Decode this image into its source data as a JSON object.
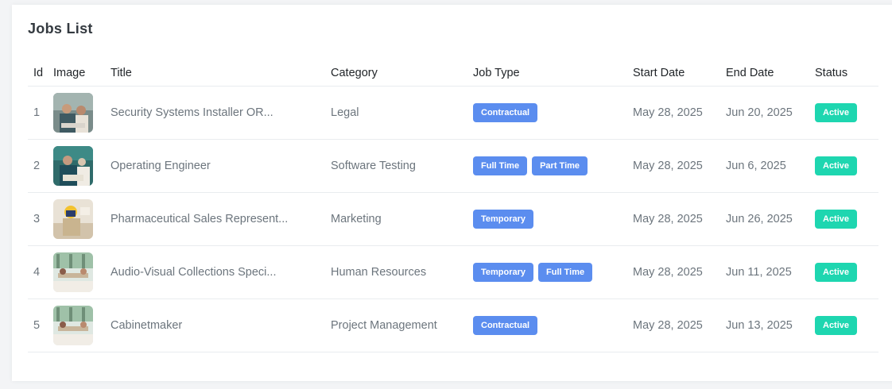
{
  "card": {
    "title": "Jobs List"
  },
  "table": {
    "headers": {
      "id": "Id",
      "image": "Image",
      "title": "Title",
      "category": "Category",
      "job_type": "Job Type",
      "start_date": "Start Date",
      "end_date": "End Date",
      "status": "Status"
    },
    "rows": [
      {
        "id": "1",
        "title": "Security Systems Installer OR...",
        "category": "Legal",
        "types": [
          "Contractual"
        ],
        "start": "May 28, 2025",
        "end": "Jun 20, 2025",
        "status": "Active"
      },
      {
        "id": "2",
        "title": "Operating Engineer",
        "category": "Software Testing",
        "types": [
          "Full Time",
          "Part Time"
        ],
        "start": "May 28, 2025",
        "end": "Jun 6, 2025",
        "status": "Active"
      },
      {
        "id": "3",
        "title": "Pharmaceutical Sales Represent...",
        "category": "Marketing",
        "types": [
          "Temporary"
        ],
        "start": "May 28, 2025",
        "end": "Jun 26, 2025",
        "status": "Active"
      },
      {
        "id": "4",
        "title": "Audio-Visual Collections Speci...",
        "category": "Human Resources",
        "types": [
          "Temporary",
          "Full Time"
        ],
        "start": "May 28, 2025",
        "end": "Jun 11, 2025",
        "status": "Active"
      },
      {
        "id": "5",
        "title": "Cabinetmaker",
        "category": "Project Management",
        "types": [
          "Contractual"
        ],
        "start": "May 28, 2025",
        "end": "Jun 13, 2025",
        "status": "Active"
      }
    ]
  },
  "colors": {
    "type_badge": "#5b8def",
    "status_badge": "#1ed6b0"
  }
}
